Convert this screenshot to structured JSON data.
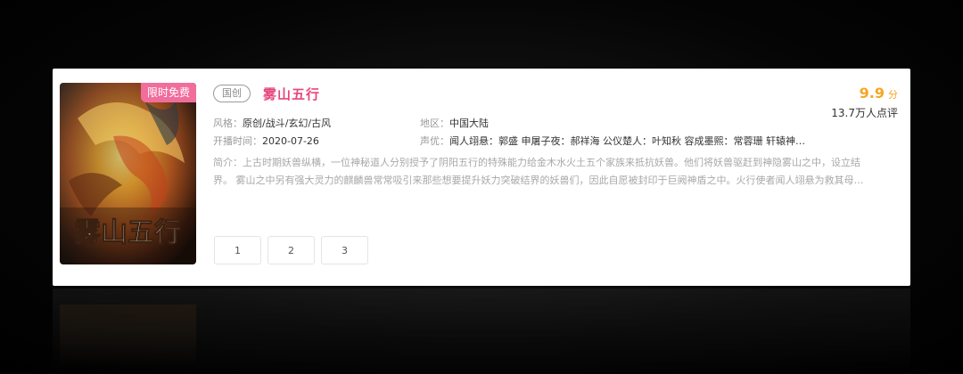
{
  "item": {
    "badge": "限时免费",
    "tag": "国创",
    "title": "雾山五行",
    "score": "9.9",
    "score_unit": "分",
    "rating_count": "13.7万人点评",
    "style_label": "风格：",
    "style_value": "原创/战斗/玄幻/古风",
    "region_label": "地区：",
    "region_value": "中国大陆",
    "date_label": "开播时间：",
    "date_value": "2020-07-26",
    "cast_label": "声优：",
    "cast_value": "闻人翊悬：郭盛 申屠子夜：郝祥海 公仪楚人：叶知秋 容成墨熙：常蓉珊 轩辕神…",
    "desc_line1": "简介：上古时期妖兽纵横，一位神秘道人分别授予了阴阳五行的特殊能力给金木水火土五个家族来抵抗妖兽。他们将妖兽驱赶到神隐雾山之中，设立结",
    "desc_line2": "界。 雾山之中另有强大灵力的麒麟兽常常吸引来那些想要提升妖力突破结界的妖兽们，因此自愿被封印于巨阙神盾之中。火行使者闻人翊悬为救其母…",
    "cover_title": "雾山五行"
  },
  "episodes": [
    "1",
    "2",
    "3"
  ],
  "colors": {
    "title": "#e8457d",
    "badge": "#f06d9c",
    "score": "#f5a623"
  }
}
